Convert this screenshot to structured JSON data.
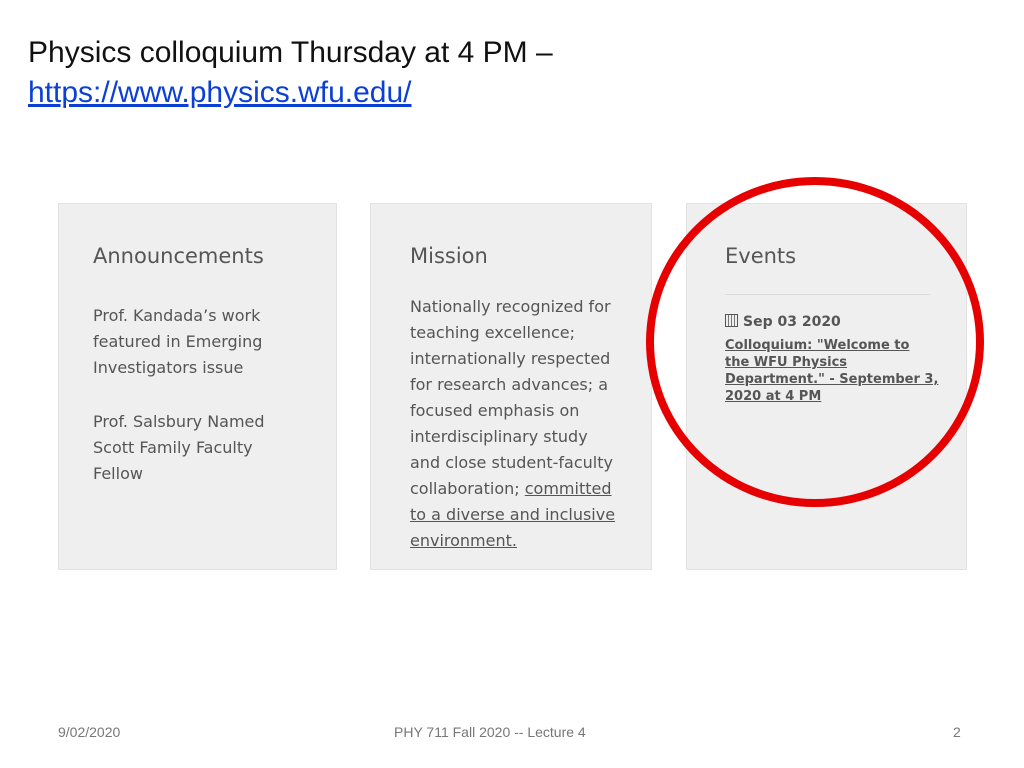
{
  "slide": {
    "title_line1": "Physics colloquium Thursday at 4 PM –",
    "title_link": "https://www.physics.wfu.edu/",
    "footer_date": "9/02/2020",
    "footer_center": "PHY 711  Fall 2020 -- Lecture 4",
    "footer_page": "2",
    "highlight_color": "#e60000"
  },
  "announcements": {
    "heading": "Announcements",
    "item1": [
      "Prof. Kandada’s work",
      "featured in Emerging",
      "Investigators issue"
    ],
    "item2": [
      "Prof. Salsbury Named",
      "Scott Family Faculty",
      "Fellow"
    ]
  },
  "mission": {
    "heading": "Mission",
    "lines": [
      "Nationally recognized for",
      "teaching excellence;",
      "internationally respected",
      "for research advances; a",
      "focused emphasis on",
      "interdisciplinary study",
      "and close student-faculty"
    ],
    "line8_plain": "collaboration; ",
    "line8_link": "committed",
    "link_lines": [
      "to a diverse and inclusive",
      "environment."
    ]
  },
  "events": {
    "heading": "Events",
    "date": "Sep 03 2020",
    "calendar_icon": "calendar-icon",
    "link_lines": [
      "Colloquium: \"Welcome to",
      "the WFU Physics",
      "Department.\" - September 3,",
      "2020 at 4 PM"
    ]
  }
}
